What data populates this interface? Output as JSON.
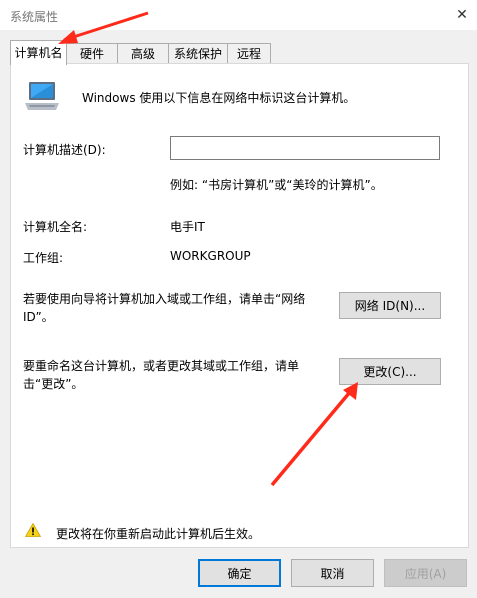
{
  "window": {
    "title": "系统属性"
  },
  "tabs": [
    {
      "label": "计算机名",
      "active": true
    },
    {
      "label": "硬件",
      "active": false
    },
    {
      "label": "高级",
      "active": false
    },
    {
      "label": "系统保护",
      "active": false
    },
    {
      "label": "远程",
      "active": false
    }
  ],
  "panel": {
    "intro": "Windows 使用以下信息在网络中标识这台计算机。",
    "desc_label": "计算机描述(D):",
    "desc_value": "",
    "example": "例如: “书房计算机”或“美玲的计算机”。",
    "fullname_label": "计算机全名:",
    "fullname_value": "电手IT",
    "workgroup_label": "工作组:",
    "workgroup_value": "WORKGROUP",
    "network_text": "若要使用向导将计算机加入域或工作组，请单击“网络 ID”。",
    "network_button": "网络 ID(N)...",
    "rename_text": "要重命名这台计算机，或者更改其域或工作组，请单击“更改”。",
    "change_button": "更改(C)...",
    "warning": "更改将在你重新启动此计算机后生效。"
  },
  "footer": {
    "ok": "确定",
    "cancel": "取消",
    "apply": "应用(A)"
  },
  "colors": {
    "annotation_arrow": "#ff2a1a",
    "focus": "#0078d7"
  }
}
